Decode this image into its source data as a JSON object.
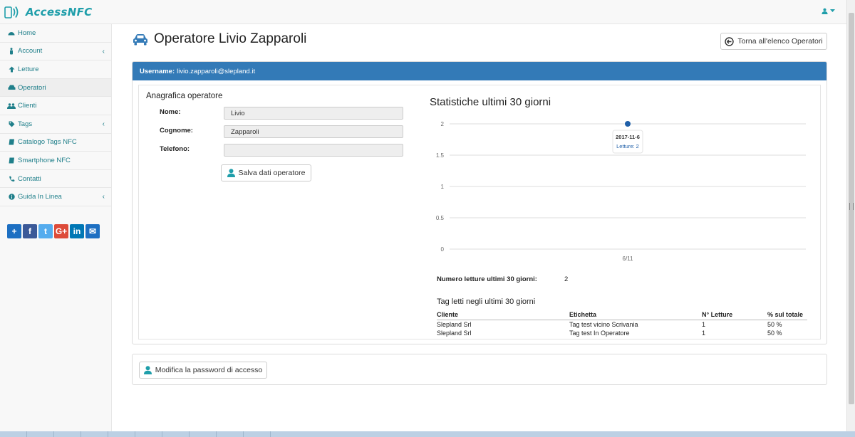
{
  "app": {
    "title": "AccessNFC"
  },
  "colors": {
    "accent": "#1f9eaa",
    "primary": "#337ab7",
    "series": "#1f5fa8"
  },
  "sidebar": {
    "items": [
      {
        "label": "Home",
        "icon": "dashboard-icon",
        "has_caret": false
      },
      {
        "label": "Account",
        "icon": "male-icon",
        "has_caret": true
      },
      {
        "label": "Letture",
        "icon": "arrow-up-icon",
        "has_caret": false
      },
      {
        "label": "Operatori",
        "icon": "car-icon",
        "has_caret": false,
        "active": true
      },
      {
        "label": "Clienti",
        "icon": "users-icon",
        "has_caret": false
      },
      {
        "label": "Tags",
        "icon": "tag-icon",
        "has_caret": true
      },
      {
        "label": "Catalogo Tags NFC",
        "icon": "book-icon",
        "has_caret": false
      },
      {
        "label": "Smartphone NFC",
        "icon": "book-icon",
        "has_caret": false
      },
      {
        "label": "Contatti",
        "icon": "phone-icon",
        "has_caret": false
      },
      {
        "label": "Guida In Linea",
        "icon": "info-icon",
        "has_caret": true
      }
    ],
    "share": [
      {
        "icon": "addthis-icon",
        "glyph": "+",
        "color": "#1d6fc2"
      },
      {
        "icon": "facebook-icon",
        "glyph": "f",
        "color": "#3b5998"
      },
      {
        "icon": "twitter-icon",
        "glyph": "t",
        "color": "#55acee"
      },
      {
        "icon": "google-plus-icon",
        "glyph": "G+",
        "color": "#dd4b39"
      },
      {
        "icon": "linkedin-icon",
        "glyph": "in",
        "color": "#0077b5"
      },
      {
        "icon": "email-icon",
        "glyph": "✉",
        "color": "#1d6fc2"
      }
    ]
  },
  "header": {
    "title": "Operatore Livio Zapparoli",
    "back_button": "Torna all'elenco Operatori"
  },
  "panel": {
    "username_label": "Username:",
    "username_value": "livio.zapparoli@slepland.it"
  },
  "form": {
    "title": "Anagrafica operatore",
    "fields": [
      {
        "label": "Nome:",
        "value": "Livio"
      },
      {
        "label": "Cognome:",
        "value": "Zapparoli"
      },
      {
        "label": "Telefono:",
        "value": ""
      }
    ],
    "save_button": "Salva dati operatore"
  },
  "stats": {
    "title": "Statistiche ultimi 30 giorni",
    "count_label": "Numero letture ultimi 30 giorni:",
    "count_value": "2",
    "tags_title": "Tag letti negli ultimi 30 giorni",
    "table": {
      "headers": [
        "Cliente",
        "Etichetta",
        "N° Letture",
        "% sul totale"
      ],
      "rows": [
        [
          "Slepland Srl",
          "Tag test vicino Scrivania",
          "1",
          "50 %"
        ],
        [
          "Slepland Srl",
          "Tag test In Operatore",
          "1",
          "50 %"
        ]
      ]
    }
  },
  "chart_data": {
    "type": "line",
    "x": [
      "6/11"
    ],
    "series": [
      {
        "values": [
          2
        ]
      }
    ],
    "ylim": [
      0,
      2
    ],
    "yticks": [
      "2",
      "1.5",
      "1",
      "0.5",
      "0"
    ],
    "grid": true,
    "tooltip": {
      "date": "2017-11-6",
      "text": "Letture: 2"
    }
  },
  "password_button": "Modifica la password di accesso"
}
